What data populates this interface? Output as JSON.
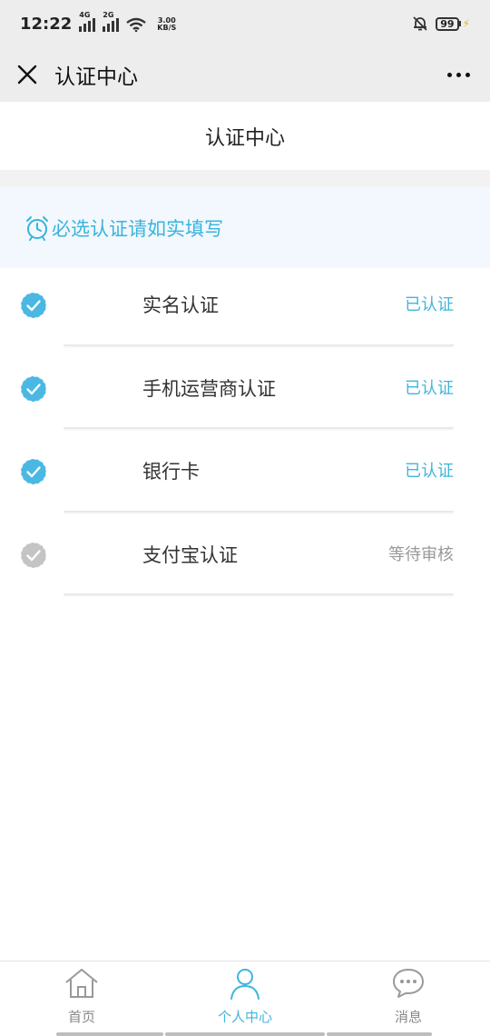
{
  "status_bar": {
    "time": "12:22",
    "net1": "4G",
    "net2": "2G",
    "speed_value": "3.00",
    "speed_unit": "KB/S",
    "battery": "99"
  },
  "nav": {
    "title": "认证中心"
  },
  "page": {
    "header": "认证中心"
  },
  "notice": {
    "text": "必选认证请如实填写",
    "color": "#39b3de"
  },
  "items": [
    {
      "label": "实名认证",
      "status": "已认证",
      "verified": true
    },
    {
      "label": "手机运营商认证",
      "status": "已认证",
      "verified": true
    },
    {
      "label": "银行卡",
      "status": "已认证",
      "verified": true
    },
    {
      "label": "支付宝认证",
      "status": "等待审核",
      "verified": false
    }
  ],
  "tabs": [
    {
      "label": "首页",
      "icon": "home-icon",
      "active": false
    },
    {
      "label": "个人中心",
      "icon": "user-icon",
      "active": true
    },
    {
      "label": "消息",
      "icon": "chat-icon",
      "active": false
    }
  ],
  "colors": {
    "accent": "#3fb5dd",
    "pending": "#bbbbbb"
  }
}
